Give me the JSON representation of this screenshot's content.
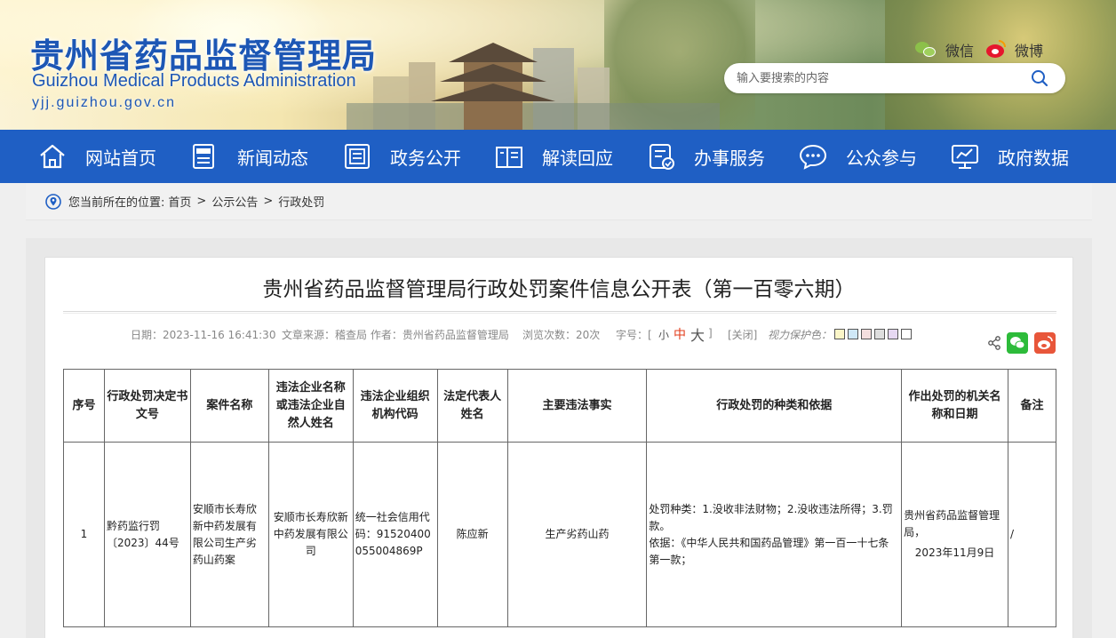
{
  "header": {
    "title_cn": "贵州省药品监督管理局",
    "title_en": "Guizhou Medical Products Administration",
    "url": "yjj.guizhou.gov.cn",
    "social": [
      {
        "label": "微信",
        "icon": "wechat-icon"
      },
      {
        "label": "微博",
        "icon": "weibo-icon"
      }
    ],
    "search_placeholder": "输入要搜索的内容"
  },
  "nav": {
    "items": [
      {
        "label": "网站首页",
        "icon": "home-icon"
      },
      {
        "label": "新闻动态",
        "icon": "news-icon"
      },
      {
        "label": "政务公开",
        "icon": "document-icon"
      },
      {
        "label": "解读回应",
        "icon": "book-icon"
      },
      {
        "label": "办事服务",
        "icon": "service-icon"
      },
      {
        "label": "公众参与",
        "icon": "chat-icon"
      },
      {
        "label": "政府数据",
        "icon": "data-icon"
      }
    ],
    "bg_color": "#1f5fc4"
  },
  "breadcrumb": {
    "prefix": "您当前所在的位置:",
    "items": [
      "首页",
      "公示公告",
      "行政处罚"
    ],
    "separator": ">"
  },
  "article": {
    "title": "贵州省药品监督管理局行政处罚案件信息公开表（第一百零六期）",
    "meta": {
      "date": "日期：2023-11-16 16:41:30",
      "source": "文章来源：稽查局 作者：贵州省药品监督管理局",
      "views": "浏览次数：20次",
      "font_size_label": "字号：[",
      "font_small": "小",
      "font_mid": "中",
      "font_big": "大",
      "font_close": "]",
      "close": "[关闭]",
      "eye_care": "视力保护色："
    },
    "swatch_colors": [
      "#fbf6c8",
      "#cfe8f7",
      "#f4dede",
      "#dedede",
      "#e6d8f2",
      "#ffffff"
    ]
  },
  "table": {
    "headers": [
      "序号",
      "行政处罚决定书文号",
      "案件名称",
      "违法企业名称或违法企业自然人姓名",
      "违法企业组织机构代码",
      "法定代表人姓名",
      "主要违法事实",
      "行政处罚的种类和依据",
      "作出处罚的机关名称和日期",
      "备注"
    ],
    "rows": [
      {
        "no": "1",
        "doc_no": "黔药监行罚〔2023〕44号",
        "case_name": "安顺市长寿欣新中药发展有限公司生产劣药山药案",
        "company": "安顺市长寿欣新中药发展有限公司",
        "org_code": "统一社会信用代码：91520400055004869P",
        "legal_rep": "陈应新",
        "fact": "生产劣药山药",
        "penalty_line1": "处罚种类：1.没收非法财物；2.没收违法所得；3.罚款。",
        "penalty_line2": "依据：《中华人民共和国药品管理》第一百一十七条第一款；",
        "authority": "贵州省药品监督管理局，",
        "date": "2023年11月9日",
        "note": "/"
      }
    ]
  }
}
